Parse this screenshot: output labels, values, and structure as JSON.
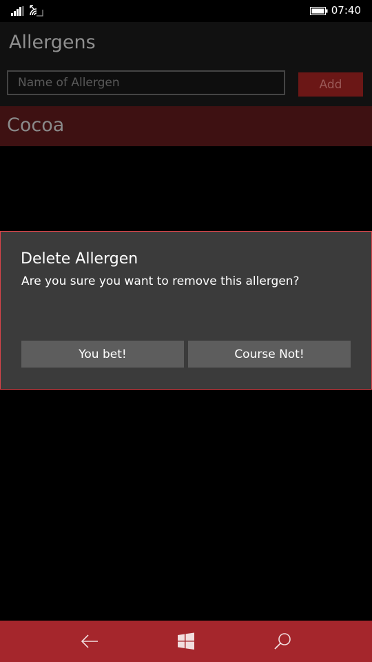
{
  "status_bar": {
    "time": "07:40",
    "icons": [
      "signal-icon",
      "wifi-icon",
      "battery-icon"
    ]
  },
  "app": {
    "title": "Allergens"
  },
  "entry": {
    "placeholder": "Name of Allergen",
    "value": "",
    "add_label": "Add"
  },
  "allergens": {
    "items": [
      {
        "label": "Cocoa"
      }
    ]
  },
  "dialog": {
    "title": "Delete Allergen",
    "message": "Are you sure you want to remove this allergen?",
    "confirm_label": "You bet!",
    "cancel_label": "Course Not!"
  },
  "navbar": {
    "icons": [
      "back-arrow-icon",
      "windows-start-icon",
      "search-icon"
    ]
  },
  "colors": {
    "accent": "#a5262c",
    "dialog_border": "#d9444a",
    "list_item_bg": "#3e1112",
    "dialog_bg": "#3b3b3b"
  }
}
